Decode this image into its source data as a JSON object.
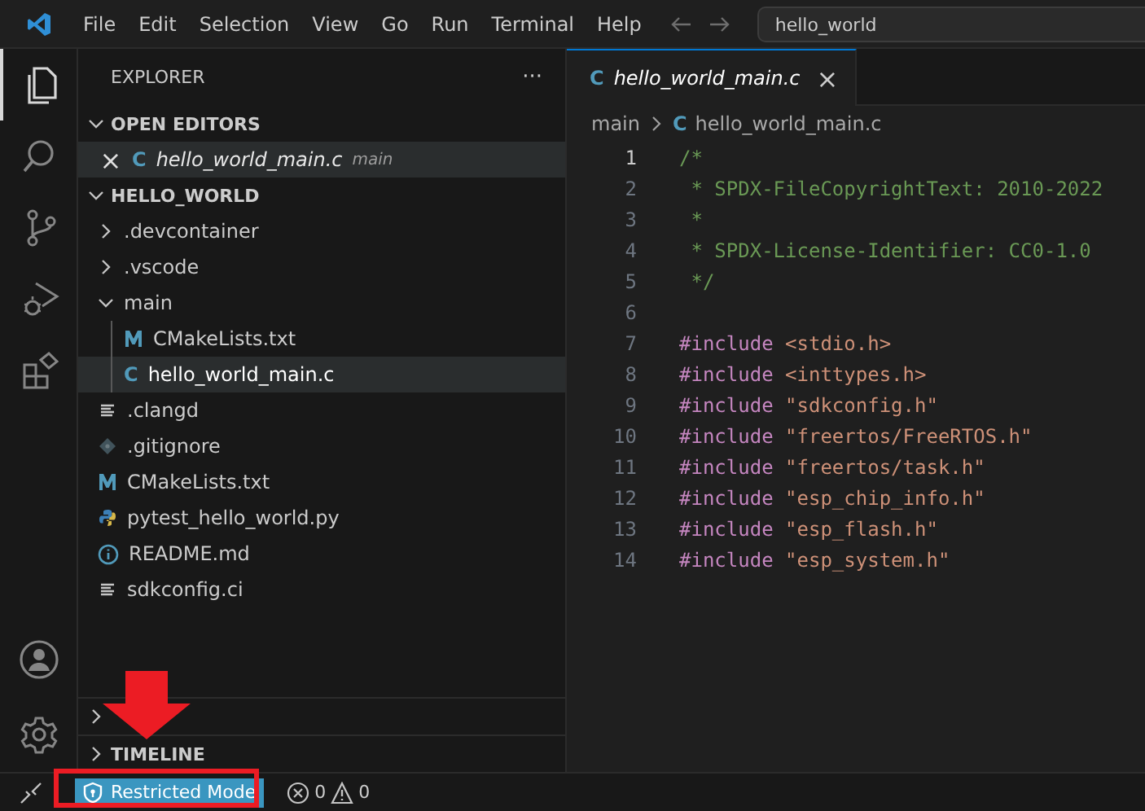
{
  "title_bar": {
    "menu": [
      "File",
      "Edit",
      "Selection",
      "View",
      "Go",
      "Run",
      "Terminal",
      "Help"
    ],
    "search": {
      "value": "hello_world"
    }
  },
  "activity_bar": [
    {
      "kind": "explorer",
      "selected": true
    },
    {
      "kind": "search",
      "selected": false
    },
    {
      "kind": "source-control",
      "selected": false
    },
    {
      "kind": "run-debug",
      "selected": false
    },
    {
      "kind": "extensions",
      "selected": false
    }
  ],
  "activity_bar_bottom": [
    {
      "kind": "account"
    },
    {
      "kind": "settings"
    }
  ],
  "sidebar": {
    "title": "EXPLORER",
    "more": "···",
    "open_editors": {
      "label": "OPEN EDITORS",
      "expanded": true,
      "items": [
        {
          "close": "×",
          "icon_text": "C",
          "name": "hello_world_main.c",
          "description": "main",
          "selected": true
        }
      ]
    },
    "folder": {
      "label": "HELLO_WORLD",
      "expanded": true,
      "children": [
        {
          "name": ".devcontainer",
          "kind": "folder",
          "expanded": false,
          "selected": false
        },
        {
          "name": ".vscode",
          "kind": "folder",
          "expanded": false,
          "selected": false
        },
        {
          "name": "main",
          "kind": "folder",
          "expanded": true,
          "selected": false,
          "children": [
            {
              "name": "CMakeLists.txt",
              "kind": "cmake",
              "selected": false
            },
            {
              "name": "hello_world_main.c",
              "kind": "c",
              "icon_text": "C",
              "selected": true
            }
          ]
        },
        {
          "name": ".clangd",
          "kind": "text",
          "selected": false
        },
        {
          "name": ".gitignore",
          "kind": "git",
          "selected": false
        },
        {
          "name": "CMakeLists.txt",
          "kind": "cmake",
          "selected": false
        },
        {
          "name": "pytest_hello_world.py",
          "kind": "python",
          "selected": false
        },
        {
          "name": "README.md",
          "kind": "info",
          "selected": false
        },
        {
          "name": "sdkconfig.ci",
          "kind": "text",
          "selected": false
        }
      ]
    },
    "bottom_sections": [
      {
        "expanded": false
      },
      {
        "label": "TIMELINE",
        "expanded": false
      }
    ]
  },
  "editor": {
    "tabs": [
      {
        "icon_text": "C",
        "label": "hello_world_main.c",
        "close": "×",
        "selected": true
      }
    ],
    "breadcrumb": [
      {
        "label": "main"
      },
      {
        "icon_text": "C",
        "label": "hello_world_main.c"
      }
    ],
    "lines": [
      {
        "number": "1",
        "active": true,
        "tokens": [
          {
            "kind": "comment",
            "text": "/*"
          }
        ]
      },
      {
        "number": "2",
        "active": false,
        "tokens": [
          {
            "kind": "comment",
            "text": " * SPDX-FileCopyrightText: 2010-2022"
          }
        ]
      },
      {
        "number": "3",
        "active": false,
        "tokens": [
          {
            "kind": "comment",
            "text": " *"
          }
        ]
      },
      {
        "number": "4",
        "active": false,
        "tokens": [
          {
            "kind": "comment",
            "text": " * SPDX-License-Identifier: CC0-1.0"
          }
        ]
      },
      {
        "number": "5",
        "active": false,
        "tokens": [
          {
            "kind": "comment",
            "text": " */"
          }
        ]
      },
      {
        "number": "6",
        "active": false
      },
      {
        "number": "7",
        "active": false,
        "tokens": [
          {
            "kind": "keyword",
            "text": "#include"
          },
          {
            "kind": "string",
            "text": "<stdio.h>"
          }
        ]
      },
      {
        "number": "8",
        "active": false,
        "tokens": [
          {
            "kind": "keyword",
            "text": "#include"
          },
          {
            "kind": "string",
            "text": "<inttypes.h>"
          }
        ]
      },
      {
        "number": "9",
        "active": false,
        "tokens": [
          {
            "kind": "keyword",
            "text": "#include"
          },
          {
            "kind": "string",
            "text": "\"sdkconfig.h\""
          }
        ]
      },
      {
        "number": "10",
        "active": false,
        "tokens": [
          {
            "kind": "keyword",
            "text": "#include"
          },
          {
            "kind": "string",
            "text": "\"freertos/FreeRTOS.h\""
          }
        ]
      },
      {
        "number": "11",
        "active": false,
        "tokens": [
          {
            "kind": "keyword",
            "text": "#include"
          },
          {
            "kind": "string",
            "text": "\"freertos/task.h\""
          }
        ]
      },
      {
        "number": "12",
        "active": false,
        "tokens": [
          {
            "kind": "keyword",
            "text": "#include"
          },
          {
            "kind": "string",
            "text": "\"esp_chip_info.h\""
          }
        ]
      },
      {
        "number": "13",
        "active": false,
        "tokens": [
          {
            "kind": "keyword",
            "text": "#include"
          },
          {
            "kind": "string",
            "text": "\"esp_flash.h\""
          }
        ]
      },
      {
        "number": "14",
        "active": false,
        "tokens": [
          {
            "kind": "keyword",
            "text": "#include"
          },
          {
            "kind": "string",
            "text": "\"esp_system.h\""
          }
        ]
      }
    ]
  },
  "status_bar": {
    "restricted_mode": "Restricted Mode",
    "errors": "0",
    "warnings": "0"
  }
}
